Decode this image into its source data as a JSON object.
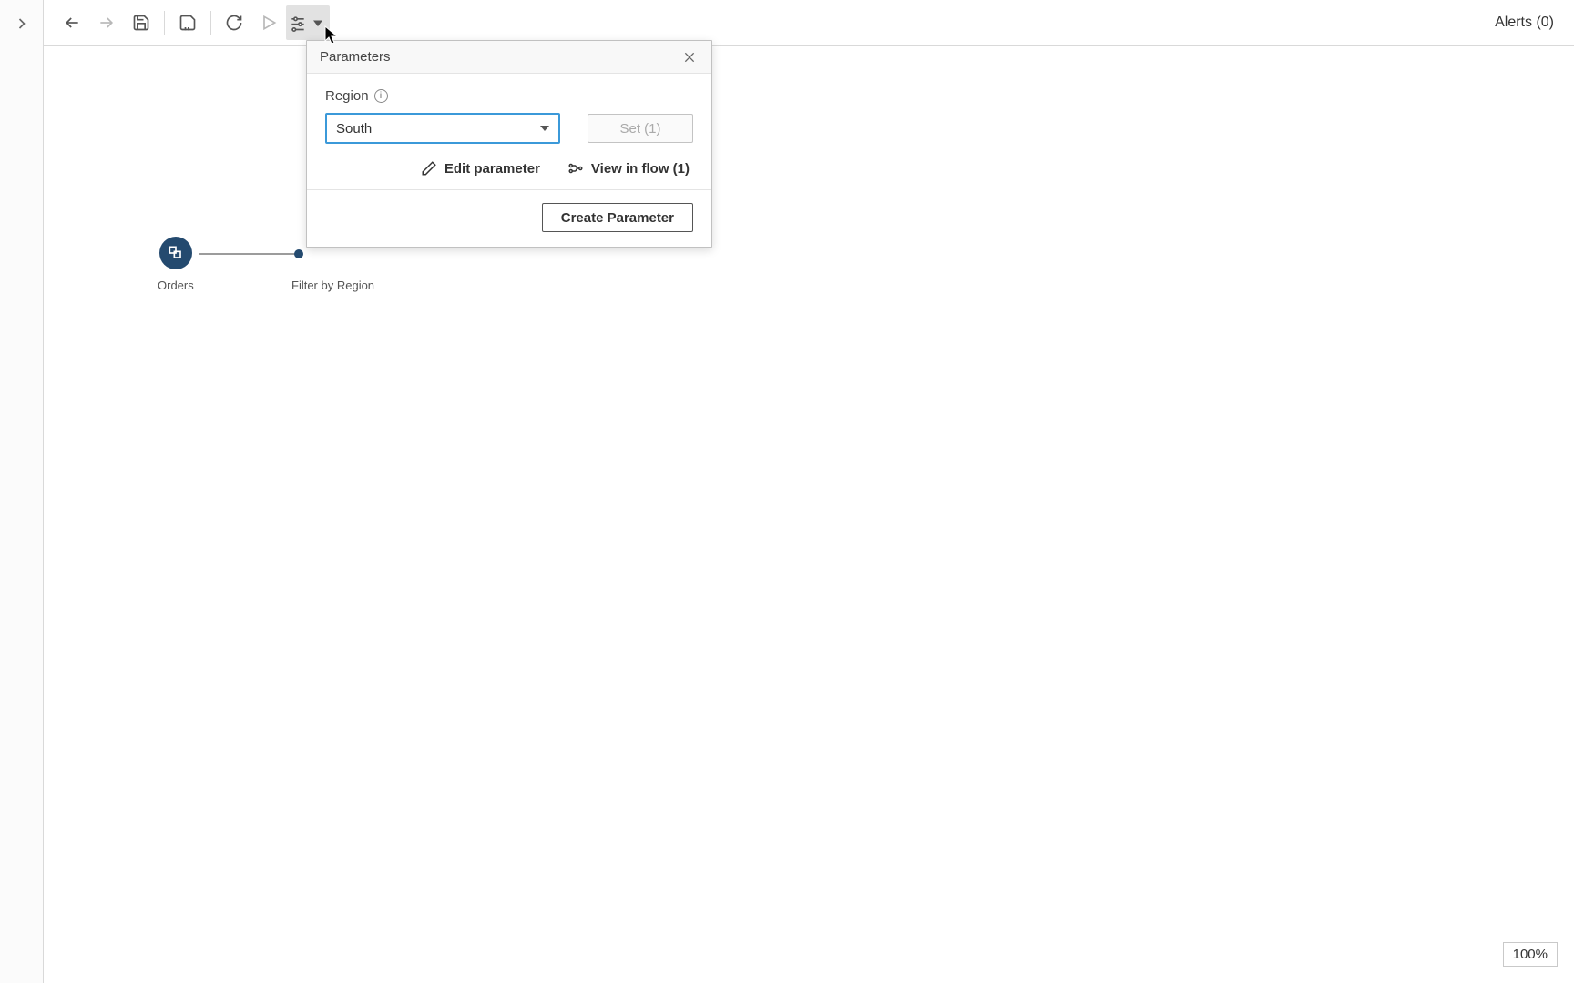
{
  "toolbar": {
    "alerts_label": "Alerts (0)"
  },
  "flow": {
    "node1_label": "Orders",
    "node2_label": "Filter by Region"
  },
  "param_panel": {
    "title": "Parameters",
    "field_label": "Region",
    "selected_value": "South",
    "set_label": "Set (1)",
    "edit_label": "Edit parameter",
    "view_label": "View in flow (1)",
    "create_label": "Create Parameter"
  },
  "zoom_label": "100%"
}
